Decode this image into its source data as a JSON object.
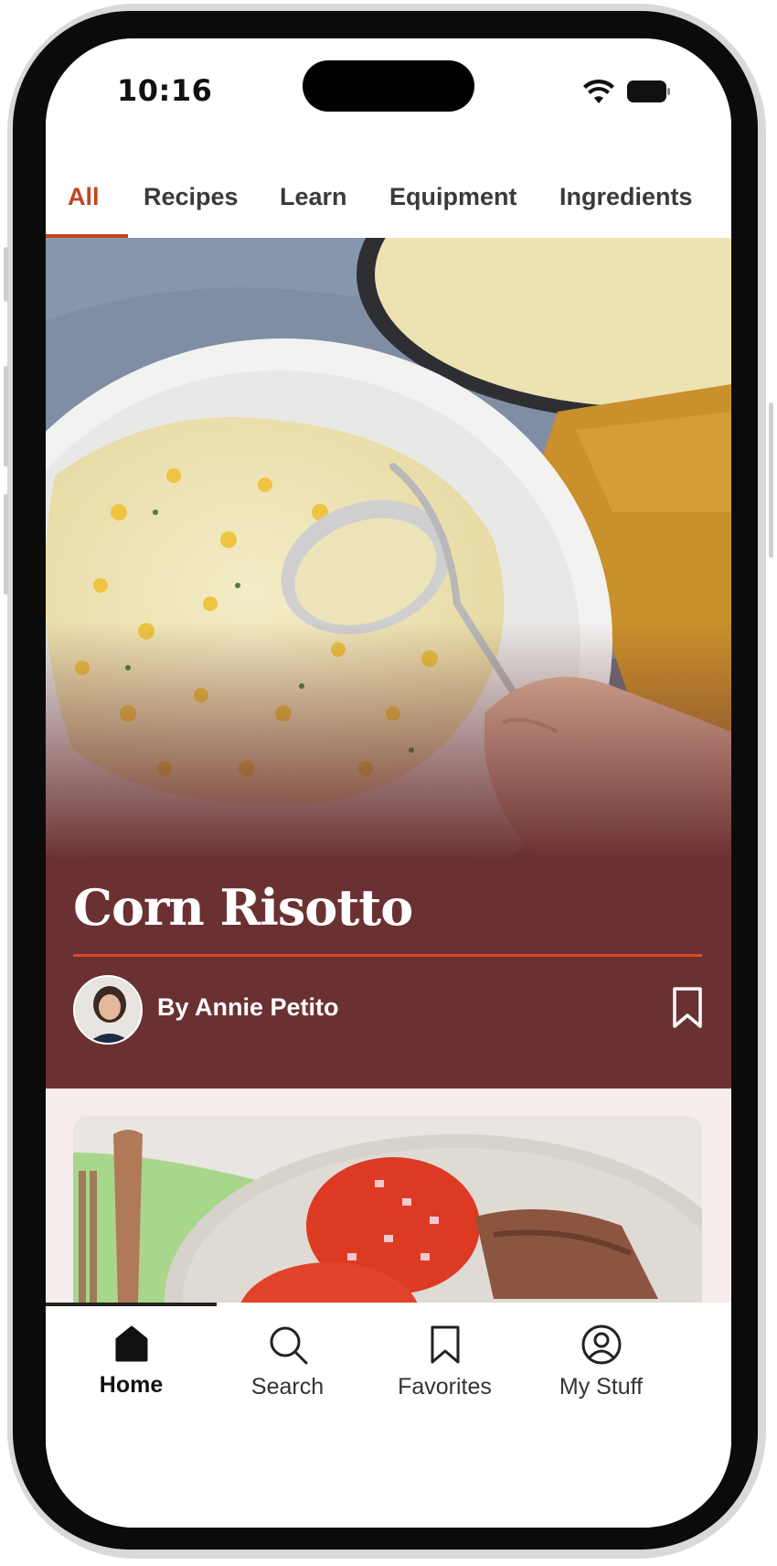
{
  "status_bar": {
    "time": "10:16"
  },
  "tabs": [
    {
      "label": "All",
      "active": true
    },
    {
      "label": "Recipes",
      "active": false
    },
    {
      "label": "Learn",
      "active": false
    },
    {
      "label": "Equipment",
      "active": false
    },
    {
      "label": "Ingredients",
      "active": false
    }
  ],
  "hero": {
    "title": "Corn Risotto",
    "author": "By Annie Petito",
    "background_color": "#6b3132",
    "accent_color": "#d64b24"
  },
  "bottom_nav": [
    {
      "label": "Home",
      "icon": "home-icon",
      "active": true
    },
    {
      "label": "Search",
      "icon": "search-icon",
      "active": false
    },
    {
      "label": "Favorites",
      "icon": "bookmark-icon",
      "active": false
    },
    {
      "label": "My Stuff",
      "icon": "profile-icon",
      "active": false
    }
  ],
  "colors": {
    "accent": "#c0451f",
    "feed_background": "#f6ecec"
  }
}
